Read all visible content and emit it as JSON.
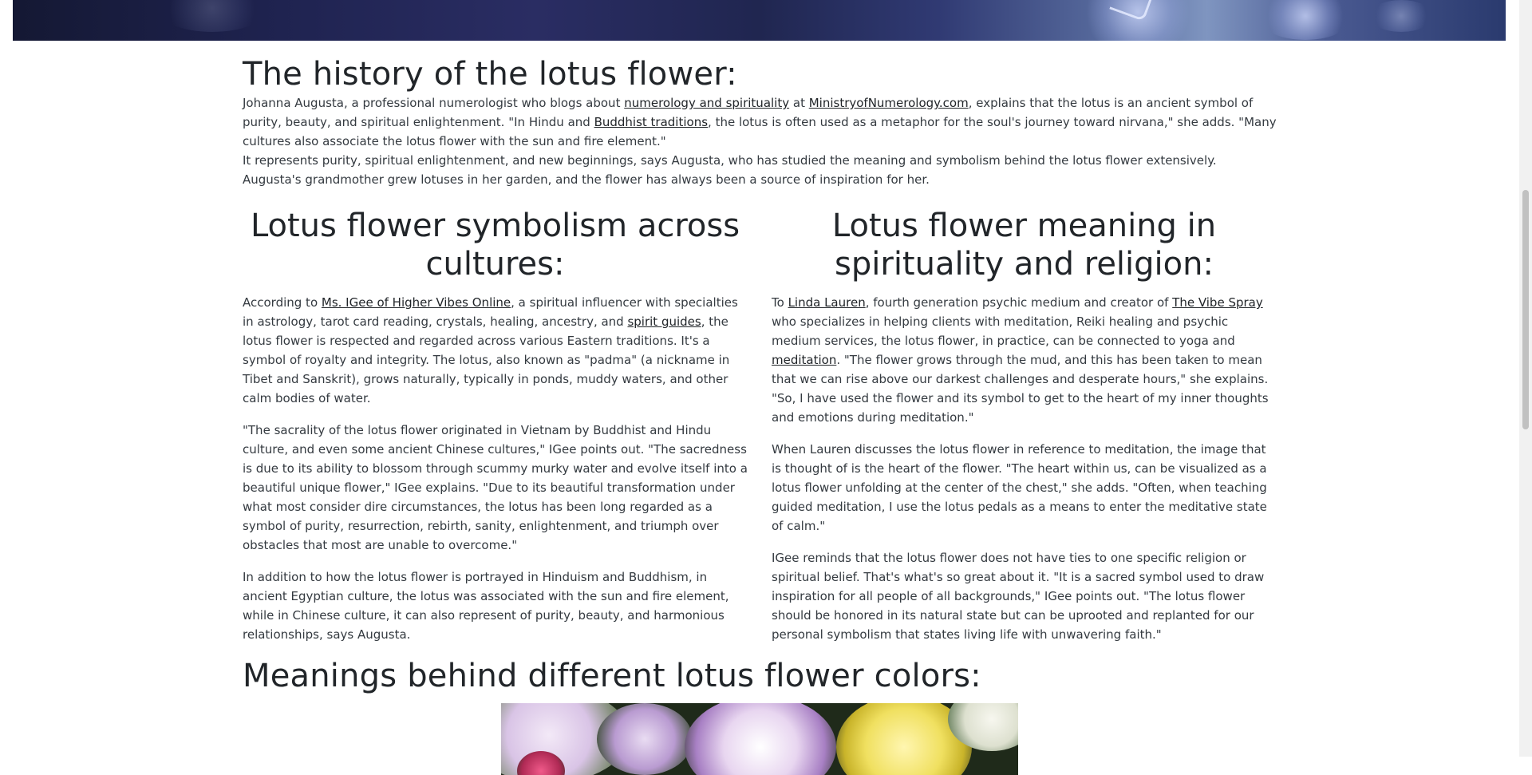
{
  "history": {
    "title": "The history of the lotus flower:",
    "p1": {
      "t1": "Johanna Augusta, a professional numerologist who blogs about ",
      "link1": "numerology and spirituality",
      "t2": " at ",
      "link2": "MinistryofNumerology.com",
      "t3": ", explains that the lotus is an ancient symbol of purity, beauty, and spiritual enlightenment. \"In Hindu and ",
      "link3": "Buddhist traditions",
      "t4": ", the lotus is often used as a metaphor for the soul's journey toward nirvana,\" she adds. \"Many cultures also associate the lotus flower with the sun and fire element.\""
    },
    "p2": "It represents purity, spiritual enlightenment, and new beginnings, says Augusta, who has studied the meaning and symbolism behind the lotus flower extensively. Augusta's grandmother grew lotuses in her garden, and the flower has always been a source of inspiration for her."
  },
  "cultures": {
    "title": "Lotus flower symbolism across cultures:",
    "p1": {
      "t1": "According to ",
      "link1": "Ms. IGee of Higher Vibes Online",
      "t2": ", a spiritual influencer with specialties in astrology, tarot card reading, crystals, healing, ancestry, and ",
      "link2": "spirit guides",
      "t3": ", the lotus flower is respected and regarded across various Eastern traditions. It's a symbol of royalty and integrity. The lotus, also known as \"padma\" (a nickname in Tibet and Sanskrit), grows naturally, typically in ponds, muddy waters, and other calm bodies of water."
    },
    "p2": "\"The sacrality of the lotus flower originated in Vietnam by Buddhist and Hindu culture, and even some ancient Chinese cultures,\" IGee points out. \"The sacredness is due to its ability to blossom through scummy murky water and evolve itself into a beautiful unique flower,\" IGee explains. \"Due to its beautiful transformation under what most consider dire circumstances, the lotus has been long regarded as a symbol of purity, resurrection, rebirth, sanity, enlightenment, and triumph over obstacles that most are unable to overcome.\"",
    "p3": "In addition to how the lotus flower is portrayed in Hinduism and Buddhism, in ancient Egyptian culture, the lotus was associated with the sun and fire element, while in Chinese culture, it can also represent of purity, beauty, and harmonious relationships, says Augusta."
  },
  "spirituality": {
    "title": "Lotus flower meaning in spirituality and religion:",
    "p1": {
      "t1": "To ",
      "link1": "Linda Lauren",
      "t2": ", fourth generation psychic medium and creator of ",
      "link2": "The Vibe Spray",
      "t3": " who specializes in helping clients with meditation, Reiki healing and psychic medium services, the lotus flower, in practice, can be connected to yoga and ",
      "link3": "meditation",
      "t4": ". \"The flower grows through the mud, and this has been taken to mean that we can rise above our darkest challenges and desperate hours,\" she explains. \"So, I have used the flower and its symbol to get to the heart of my inner thoughts and emotions during meditation.\""
    },
    "p2": "When Lauren discusses the lotus flower in reference to meditation, the image that is thought of is the heart of the flower. \"The heart within us, can be visualized as a lotus flower unfolding at the center of the chest,\" she adds. \"Often, when teaching guided meditation, I use the lotus pedals as a means to enter the meditative state of calm.\"",
    "p3": "IGee reminds that the lotus flower does not have ties to one specific religion or spiritual belief. That's what's so great about it. \"It is a sacred symbol used to draw inspiration for all people of all backgrounds,\" IGee points out. \"The lotus flower should be honored in its natural state but can be uprooted and replanted for our personal symbolism that states living life with unwavering faith.\""
  },
  "colors": {
    "title": "Meanings behind different lotus flower colors:"
  },
  "theme": {
    "text": "#212529",
    "body_text": "#343a40",
    "hero_dark": "#1f2350",
    "hero_light": "#7f95c0"
  }
}
